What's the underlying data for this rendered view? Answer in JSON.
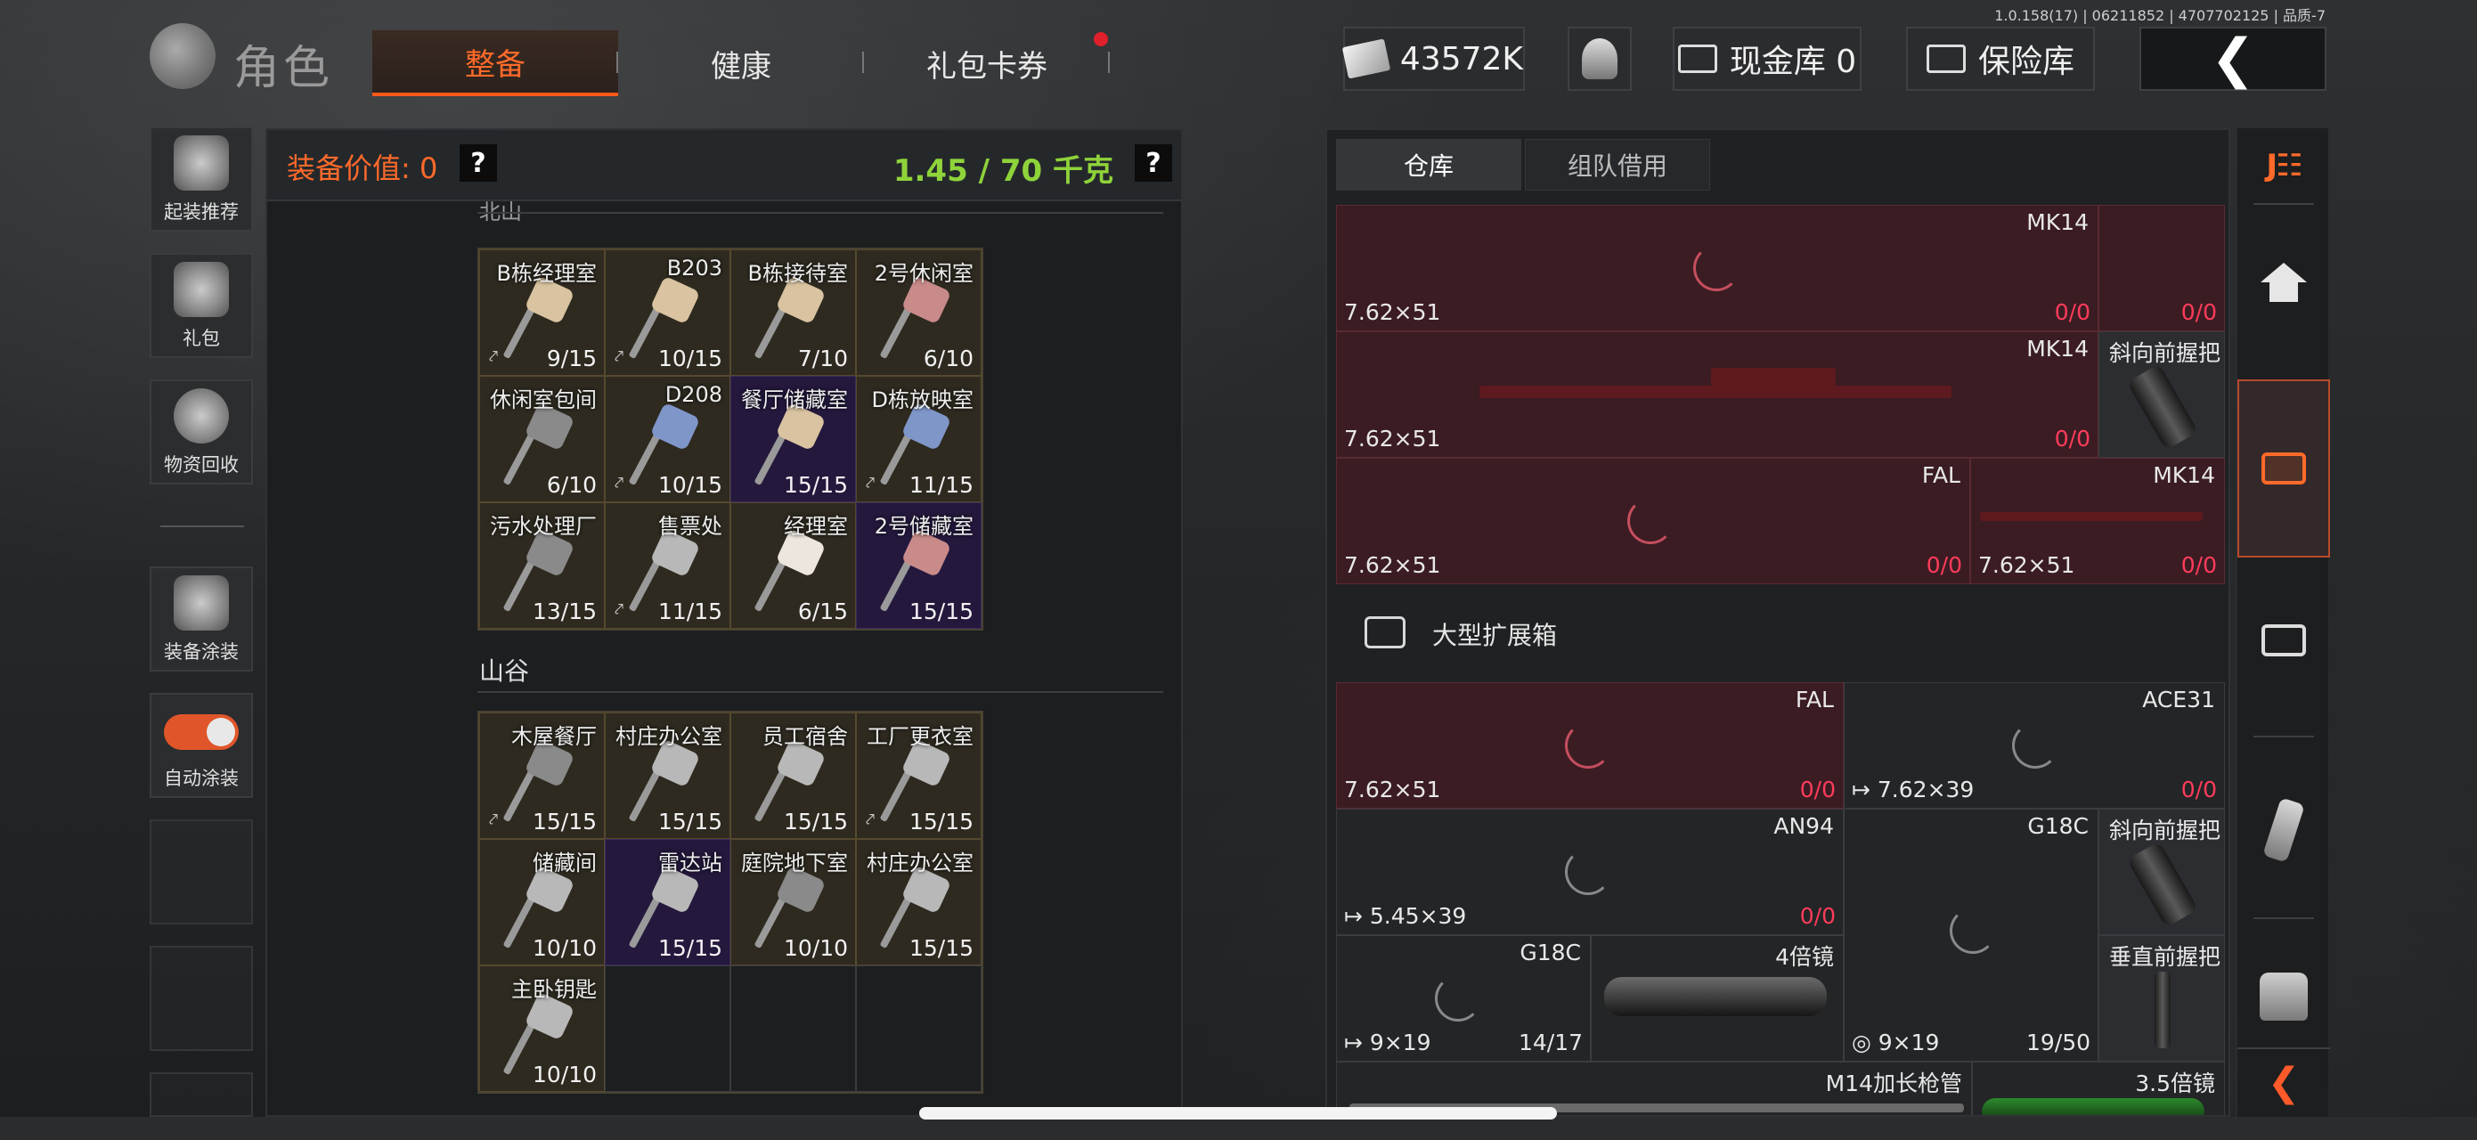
{
  "version": "1.0.158(17) | 06211852 | 4707702125 | 品质-7",
  "header": {
    "logo_text": "角色",
    "tabs": [
      {
        "label": "整备",
        "active": true
      },
      {
        "label": "健康",
        "active": false
      },
      {
        "label": "礼包卡券",
        "active": false,
        "has_notification": true
      }
    ],
    "currency": "43572K",
    "cash_vault": "现金库 0",
    "safe": "保险库",
    "back_icon": "chevron-left-icon"
  },
  "sidebar": {
    "items": [
      {
        "label": "起装推荐",
        "icon": "helmet-recommend-icon"
      },
      {
        "label": "礼包",
        "icon": "gift-icon"
      },
      {
        "label": "物资回收",
        "icon": "recycle-icon"
      },
      {
        "label": "装备涂装",
        "icon": "paint-helmet-icon"
      },
      {
        "label": "自动涂装",
        "icon": "toggle-icon",
        "toggle_on": true
      }
    ]
  },
  "equipment": {
    "value_label": "装备价值: 0",
    "weight": "1.45 / 70 千克",
    "help": "?"
  },
  "key_sections": [
    {
      "title": "北山",
      "keys": [
        {
          "name": "B栋经理室",
          "count": "9/15",
          "color": "beige",
          "rarity": "gold",
          "marked": true
        },
        {
          "name": "B203",
          "count": "10/15",
          "color": "beige",
          "rarity": "gold",
          "marked": true
        },
        {
          "name": "B栋接待室",
          "count": "7/10",
          "color": "beige",
          "rarity": "gold",
          "marked": false
        },
        {
          "name": "2号休闲室",
          "count": "6/10",
          "color": "pink",
          "rarity": "gold",
          "marked": false
        },
        {
          "name": "休闲室包间",
          "count": "6/10",
          "color": "gray",
          "rarity": "gold",
          "marked": false
        },
        {
          "name": "D208",
          "count": "10/15",
          "color": "blue",
          "rarity": "gold",
          "marked": true
        },
        {
          "name": "餐厅储藏室",
          "count": "15/15",
          "color": "beige",
          "rarity": "purple",
          "marked": false
        },
        {
          "name": "D栋放映室",
          "count": "11/15",
          "color": "blue",
          "rarity": "gold",
          "marked": true
        },
        {
          "name": "污水处理厂",
          "count": "13/15",
          "color": "gray",
          "rarity": "gold",
          "marked": false
        },
        {
          "name": "售票处",
          "count": "11/15",
          "color": "silver",
          "rarity": "gold",
          "marked": true
        },
        {
          "name": "经理室",
          "count": "6/15",
          "color": "white",
          "rarity": "gold",
          "marked": false
        },
        {
          "name": "2号储藏室",
          "count": "15/15",
          "color": "pink",
          "rarity": "purple",
          "marked": false
        }
      ]
    },
    {
      "title": "山谷",
      "keys": [
        {
          "name": "木屋餐厅",
          "count": "15/15",
          "color": "gray",
          "rarity": "gold",
          "marked": true
        },
        {
          "name": "村庄办公室",
          "count": "15/15",
          "color": "silver",
          "rarity": "gold",
          "marked": false
        },
        {
          "name": "员工宿舍",
          "count": "15/15",
          "color": "silver",
          "rarity": "gold",
          "marked": false
        },
        {
          "name": "工厂更衣室",
          "count": "15/15",
          "color": "silver",
          "rarity": "gold",
          "marked": true
        },
        {
          "name": "储藏间",
          "count": "10/10",
          "color": "silver",
          "rarity": "gold",
          "marked": false
        },
        {
          "name": "雷达站",
          "count": "15/15",
          "color": "silver",
          "rarity": "purple",
          "marked": false
        },
        {
          "name": "庭院地下室",
          "count": "10/10",
          "color": "gray",
          "rarity": "gold",
          "marked": false
        },
        {
          "name": "村庄办公室",
          "count": "15/15",
          "color": "silver",
          "rarity": "gold",
          "marked": false
        },
        {
          "name": "主卧钥匙",
          "count": "10/10",
          "color": "silver",
          "rarity": "gold",
          "marked": false
        }
      ]
    }
  ],
  "warehouse": {
    "tabs": [
      {
        "label": "仓库",
        "active": true
      },
      {
        "label": "组队借用",
        "active": false
      }
    ],
    "top_rows": [
      {
        "name": "MK14",
        "caliber": "7.62×51",
        "ammo": "0/0",
        "side_ammo": "0/0"
      },
      {
        "name": "MK14",
        "caliber": "7.62×51",
        "ammo": "0/0",
        "side_name": "斜向前握把"
      },
      {
        "name": "FAL",
        "caliber": "7.62×51",
        "ammo": "0/0",
        "side_name": "MK14",
        "side_caliber": "7.62×51",
        "side_ammo": "0/0"
      }
    ],
    "expand_label": "大型扩展箱",
    "expand_rows": [
      {
        "left_name": "FAL",
        "left_caliber": "7.62×51",
        "left_ammo": "0/0",
        "right_name": "ACE31",
        "right_caliber": "7.62×39",
        "right_ammo": "0/0"
      },
      {
        "left_name": "AN94",
        "left_caliber": "5.45×39",
        "left_ammo": "0/0",
        "mid_name": "G18C",
        "side_name": "斜向前握把"
      },
      {
        "left_name": "G18C",
        "left_caliber": "9×19",
        "left_ammo": "14/17",
        "scope_name": "4倍镜",
        "mid_caliber": "9×19",
        "mid_ammo": "19/50",
        "side_name": "垂直前握把"
      },
      {
        "left_name": "M14加长枪管",
        "side_name": "3.5倍镜"
      }
    ]
  },
  "rail": {
    "items": [
      {
        "icon": "jf-logo-icon"
      },
      {
        "icon": "home-icon"
      },
      {
        "icon": "warehouse-box-icon",
        "active": true
      },
      {
        "icon": "storage-crate-icon"
      },
      {
        "icon": "magazine-icon"
      },
      {
        "icon": "vest-icon"
      },
      {
        "icon": "collapse-arrow-icon"
      }
    ]
  }
}
